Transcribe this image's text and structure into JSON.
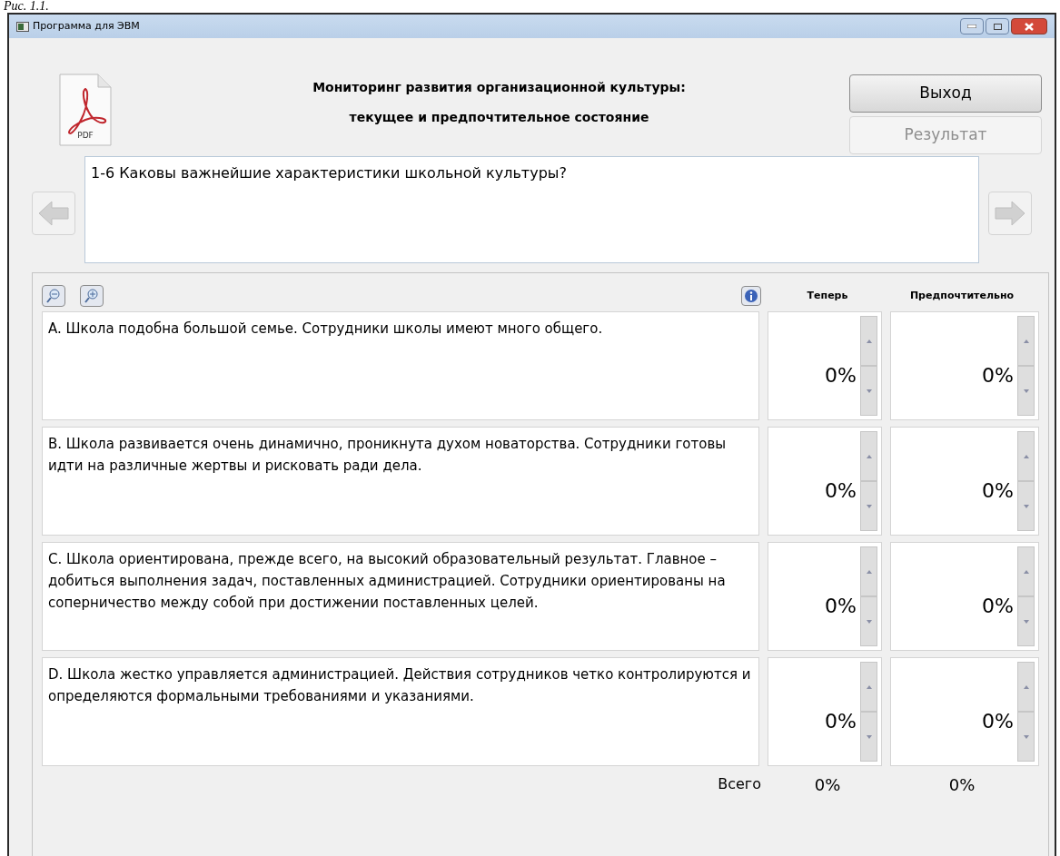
{
  "caption": "Рис. 1.1.",
  "window": {
    "title": "Программа для ЭВМ"
  },
  "header": {
    "file_label": "PDF",
    "title_lines": [
      "Мониторинг развития организационной культуры:",
      "текущее и предпочтительное состояние"
    ]
  },
  "buttons": [
    {
      "label": "Выход",
      "disabled": false
    },
    {
      "label": "Результат",
      "disabled": true
    }
  ],
  "question": {
    "value": "1-6 Каковы важнейшие характеристики школьной культуры?"
  },
  "nav": {
    "prev_disabled": true,
    "next_disabled": true
  },
  "columns": [
    "Теперь",
    "Предпочтительно"
  ],
  "rows": [
    {
      "text": "A. Школа подобна большой семье. Сотрудники школы имеют много общего.",
      "now": "0%",
      "preferred": "0%"
    },
    {
      "text": "B. Школа развивается очень динамично, проникнута духом новаторства. Сотрудники готовы идти на различные жертвы и рисковать ради дела.",
      "now": "0%",
      "preferred": "0%"
    },
    {
      "text": "C. Школа ориентирована, прежде всего, на высокий образовательный результат. Главное – добиться выполнения задач, поставленных администрацией. Сотрудники ориентированы на соперничество между собой при достижении поставленных целей.",
      "now": "0%",
      "preferred": "0%"
    },
    {
      "text": "D. Школа жестко управляется администрацией. Действия сотрудников четко контролируются и определяются формальными требованиями и указаниями.",
      "now": "0%",
      "preferred": "0%"
    }
  ],
  "totals": {
    "label": "Всего",
    "now": "0%",
    "preferred": "0%"
  }
}
